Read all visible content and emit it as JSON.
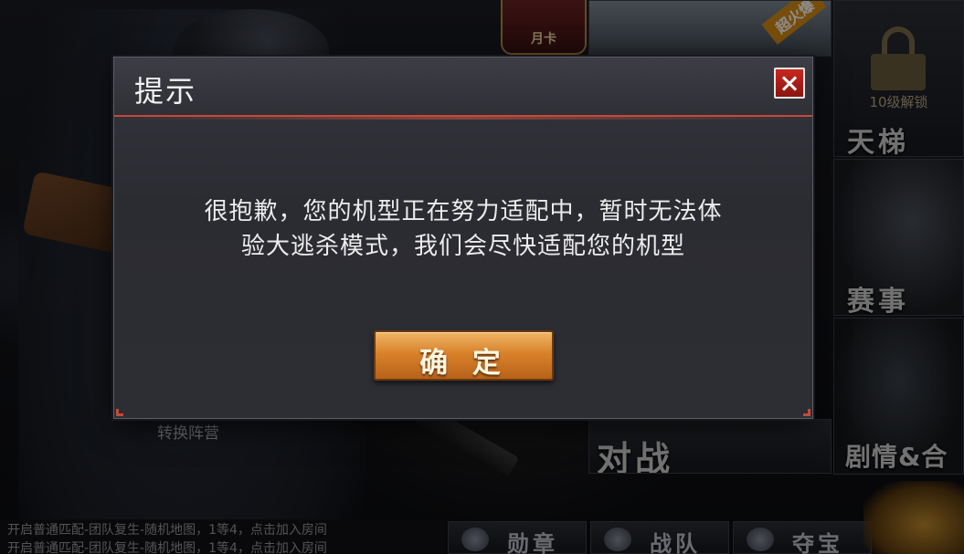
{
  "background": {
    "month_card_label": "月卡",
    "hot_badge": "超火爆",
    "lock_text": "10级解锁",
    "tiles": {
      "ladder": "天梯",
      "tournament": "赛事",
      "battle": "对战",
      "story": "剧情&合"
    },
    "camp_switch": "转换阵营",
    "ticker": [
      "开启普通匹配-团队复生-随机地图，1等4，点击加入房间",
      "开启普通匹配-团队复生-随机地图，1等4，点击加入房间"
    ],
    "bottom_buttons": [
      "勋章",
      "战队",
      "夺宝"
    ]
  },
  "dialog": {
    "title": "提示",
    "message_line1": "很抱歉，您的机型正在努力适配中，暂时无法体",
    "message_line2": "验大逃杀模式，我们会尽快适配您的机型",
    "confirm_label": "确 定"
  },
  "colors": {
    "accent_red": "#c24a3a",
    "button_orange": "#d9822a",
    "close_red": "#c9271f"
  }
}
